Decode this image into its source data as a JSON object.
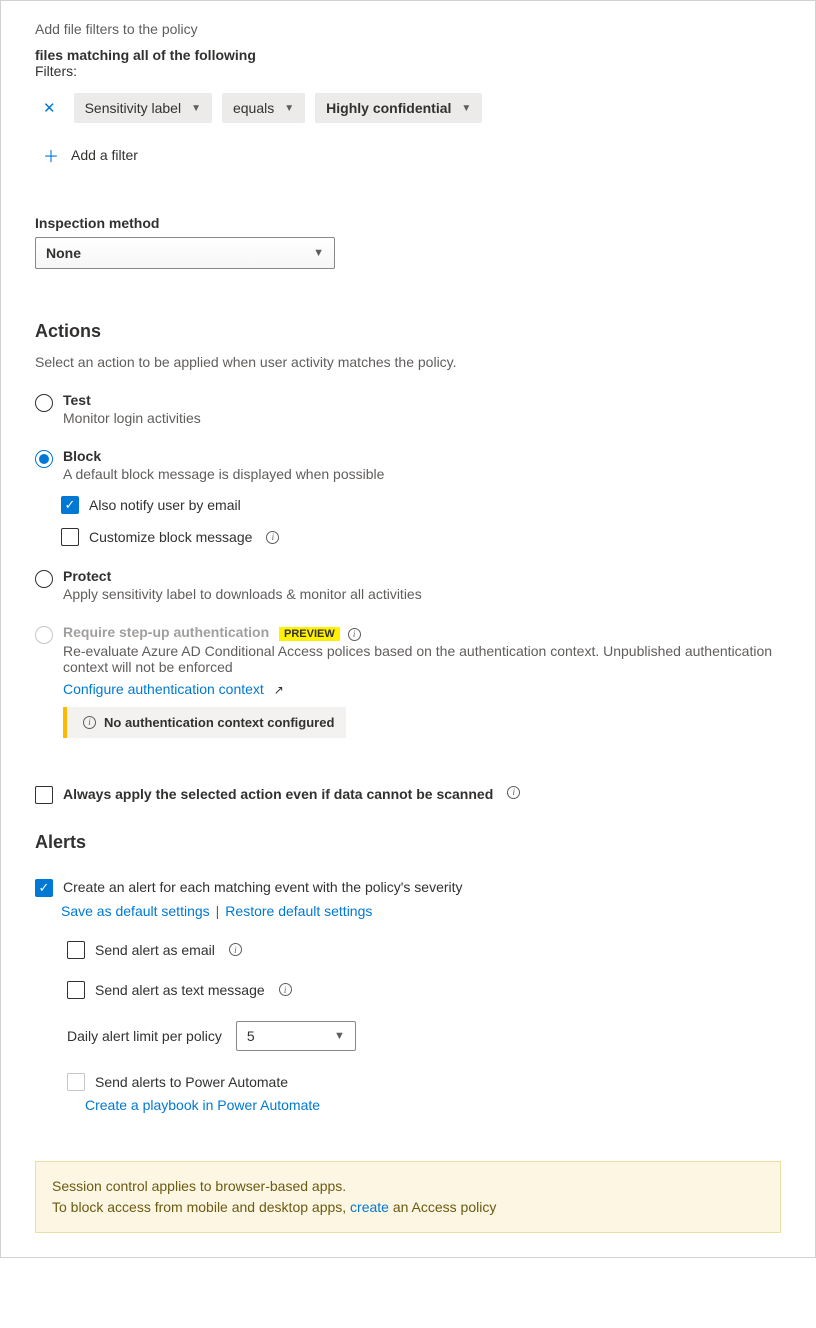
{
  "header": {
    "title": "Add file filters to the policy",
    "condition": "files matching all of the following",
    "filters_label": "Filters:"
  },
  "filter": {
    "field": "Sensitivity label",
    "op": "equals",
    "value": "Highly confidential",
    "add": "Add a filter"
  },
  "inspection": {
    "label": "Inspection method",
    "value": "None"
  },
  "actions": {
    "heading": "Actions",
    "desc": "Select an action to be applied when user activity matches the policy.",
    "test": {
      "title": "Test",
      "desc": "Monitor login activities"
    },
    "block": {
      "title": "Block",
      "desc": "A default block message is displayed when possible",
      "notify": "Also notify user by email",
      "customize": "Customize block message"
    },
    "protect": {
      "title": "Protect",
      "desc": "Apply sensitivity label to downloads & monitor all activities"
    },
    "stepup": {
      "title": "Require step-up authentication",
      "badge": "PREVIEW",
      "desc": "Re-evaluate Azure AD Conditional Access polices based on the authentication context. Unpublished authentication context will not be enforced",
      "configure": "Configure authentication context",
      "warn": "No authentication context configured"
    },
    "always_apply": "Always apply the selected action even if data cannot be scanned"
  },
  "alerts": {
    "heading": "Alerts",
    "create": "Create an alert for each matching event with the policy's severity",
    "save_default": "Save as default settings",
    "restore": "Restore default settings",
    "email": "Send alert as email",
    "text": "Send alert as text message",
    "limit_label": "Daily alert limit per policy",
    "limit_value": "5",
    "power_automate": "Send alerts to Power Automate",
    "playbook": "Create a playbook in Power Automate"
  },
  "note": {
    "line1": "Session control applies to browser-based apps.",
    "line2_a": "To block access from mobile and desktop apps, ",
    "line2_link": "create",
    "line2_b": " an Access policy"
  }
}
